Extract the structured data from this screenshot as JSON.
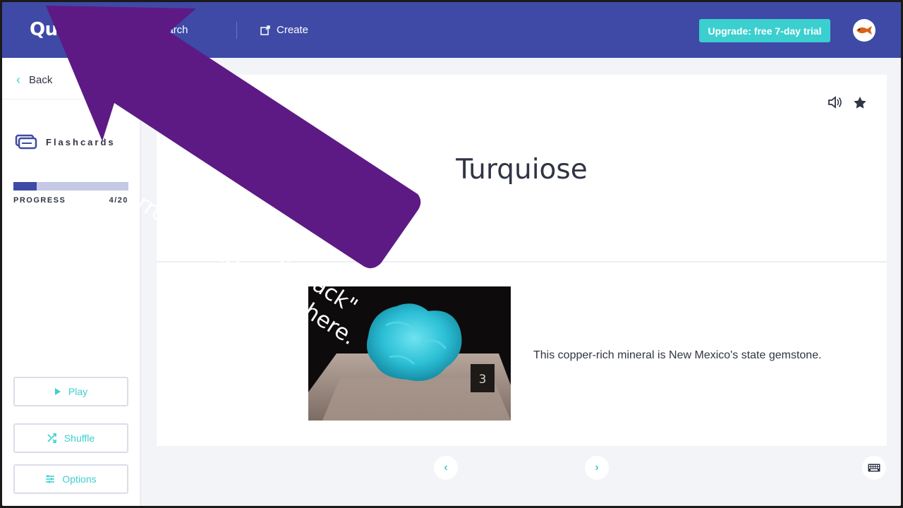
{
  "header": {
    "logo_text": "Qu",
    "search_label": "Search",
    "create_label": "Create",
    "upgrade_label": "Upgrade: free 7-day trial",
    "brand_color": "#3e4aa6",
    "accent_color": "#3ccfcf"
  },
  "sidebar": {
    "back_label": "Back",
    "mode_label": "Flashcards",
    "progress_label": "PROGRESS",
    "progress_count": "4/20",
    "progress_value": 0.2,
    "buttons": {
      "play": "Play",
      "shuffle": "Shuffle",
      "options": "Options"
    }
  },
  "card": {
    "term": "Turquiose",
    "definition": "This copper-rich mineral is New Mexico's state gemstone.",
    "image_label": "3"
  },
  "overlay": {
    "line1": "Your browser's \"back\"",
    "line2": "arrow is usually up here.",
    "color": "#5d1a85"
  }
}
